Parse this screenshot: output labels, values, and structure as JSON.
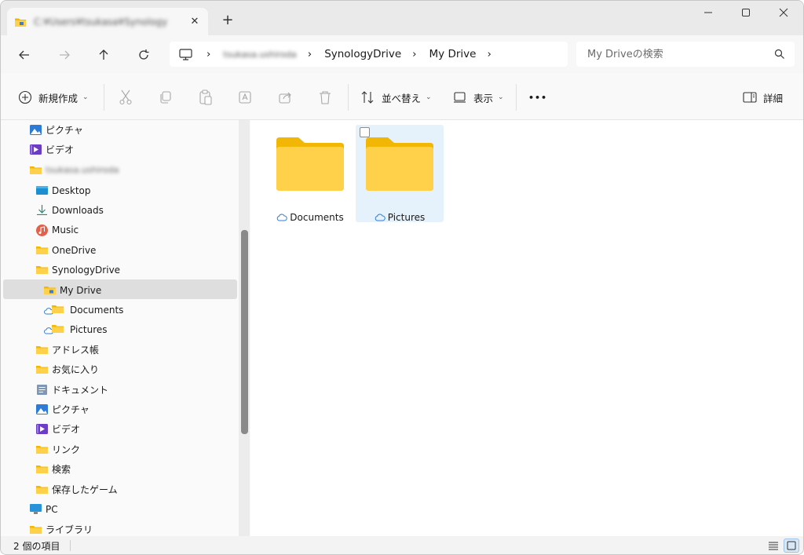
{
  "tab": {
    "title": "C:¥Users¥tsukasa¥Synology",
    "close": "✕",
    "new_tab": "+"
  },
  "window_controls": {
    "minimize": "—",
    "maximize": "☐",
    "close": "✕"
  },
  "address": {
    "crumbs": [
      "tsukasa.ushiroda",
      "SynologyDrive",
      "My Drive"
    ],
    "separator": "›"
  },
  "search": {
    "placeholder": "My Driveの検索"
  },
  "toolbar": {
    "new_label": "新規作成",
    "sort_label": "並べ替え",
    "view_label": "表示",
    "more_label": "•••",
    "details_label": "詳細"
  },
  "sidebar": {
    "items": [
      {
        "label": "ピクチャ",
        "icon": "pictures-icon"
      },
      {
        "label": "ビデオ",
        "icon": "videos-icon"
      },
      {
        "label": "tsukasa.ushiroda",
        "icon": "folder-icon"
      },
      {
        "label": "Desktop",
        "icon": "desktop-icon"
      },
      {
        "label": "Downloads",
        "icon": "download-icon"
      },
      {
        "label": "Music",
        "icon": "music-icon"
      },
      {
        "label": "OneDrive",
        "icon": "folder-icon"
      },
      {
        "label": "SynologyDrive",
        "icon": "folder-icon"
      },
      {
        "label": "My Drive",
        "icon": "synology-folder-icon"
      },
      {
        "label": "Documents",
        "icon": "cloud-folder-icon"
      },
      {
        "label": "Pictures",
        "icon": "cloud-folder-icon"
      },
      {
        "label": "アドレス帳",
        "icon": "folder-icon"
      },
      {
        "label": "お気に入り",
        "icon": "folder-icon"
      },
      {
        "label": "ドキュメント",
        "icon": "documents-icon"
      },
      {
        "label": "ピクチャ",
        "icon": "pictures-icon"
      },
      {
        "label": "ビデオ",
        "icon": "videos-icon"
      },
      {
        "label": "リンク",
        "icon": "folder-icon"
      },
      {
        "label": "検索",
        "icon": "folder-icon"
      },
      {
        "label": "保存したゲーム",
        "icon": "folder-icon"
      },
      {
        "label": "PC",
        "icon": "pc-icon"
      },
      {
        "label": "ライブラリ",
        "icon": "folder-icon"
      }
    ]
  },
  "folders": [
    {
      "name": "Documents",
      "selected": false
    },
    {
      "name": "Pictures",
      "selected": true
    }
  ],
  "status": {
    "item_count": "2 個の項目"
  },
  "colors": {
    "folder_back": "#f2b705",
    "folder_front": "#ffd04a",
    "selection": "#e5f1fb",
    "cloud": "#2f7fd6"
  }
}
